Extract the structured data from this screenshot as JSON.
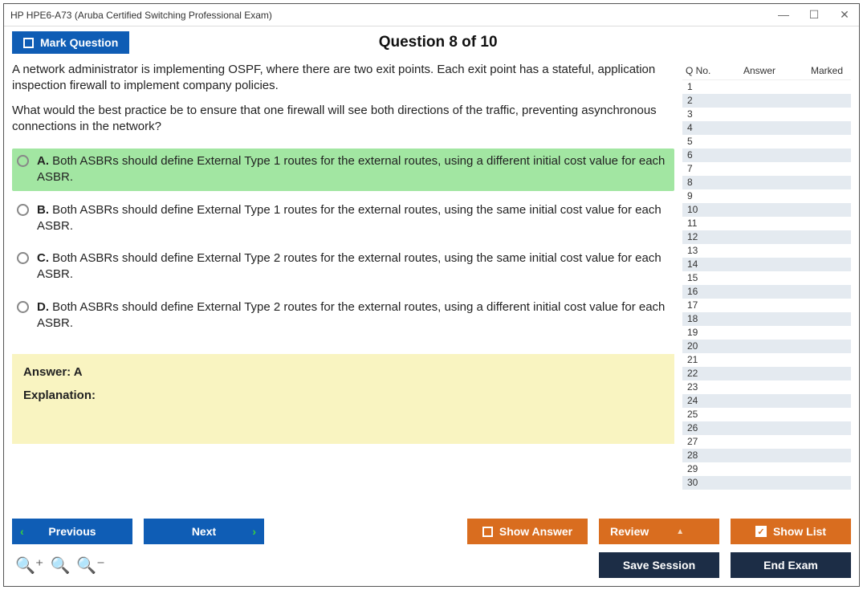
{
  "window_title": "HP HPE6-A73 (Aruba Certified Switching Professional Exam)",
  "header": {
    "mark_label": "Mark Question",
    "question_counter": "Question 8 of 10"
  },
  "question": {
    "para1": "A network administrator is implementing OSPF, where there are two exit points. Each exit point has a stateful, application inspection firewall to implement company policies.",
    "para2": "What would the best practice be to ensure that one firewall will see both directions of the traffic, preventing asynchronous connections in the network?"
  },
  "options": {
    "a": {
      "letter": "A.",
      "text": " Both ASBRs should define External Type 1 routes for the external routes, using a different initial cost value for each ASBR."
    },
    "b": {
      "letter": "B.",
      "text": " Both ASBRs should define External Type 1 routes for the external routes, using the same initial cost value for each ASBR."
    },
    "c": {
      "letter": "C.",
      "text": " Both ASBRs should define External Type 2 routes for the external routes, using the same initial cost value for each ASBR."
    },
    "d": {
      "letter": "D.",
      "text": " Both ASBRs should define External Type 2 routes for the external routes, using a different initial cost value for each ASBR."
    }
  },
  "answer_box": {
    "answer": "Answer: A",
    "explanation": "Explanation:"
  },
  "side": {
    "h1": "Q No.",
    "h2": "Answer",
    "h3": "Marked",
    "count": 30
  },
  "footer": {
    "previous": "Previous",
    "next": "Next",
    "show_answer": "Show Answer",
    "review": "Review",
    "show_list": "Show List",
    "save_session": "Save Session",
    "end_exam": "End Exam"
  }
}
